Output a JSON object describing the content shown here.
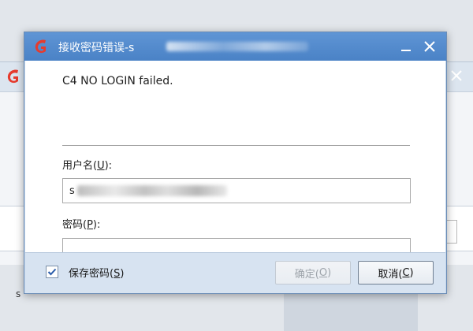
{
  "background_window": {
    "partial_letter": "s"
  },
  "dialog": {
    "title": "接收密码错误-s",
    "error_message": "C4 NO LOGIN failed.",
    "username": {
      "label": "用户名(",
      "mnemonic": "U",
      "label_end": "):",
      "value": "s"
    },
    "password": {
      "label": "密码(",
      "mnemonic": "P",
      "label_end": "):",
      "value": ""
    },
    "save_password": {
      "label": "保存密码(",
      "mnemonic": "S",
      "label_end": ")",
      "checked": true
    },
    "ok_button": {
      "label": "确定(",
      "mnemonic": "O",
      "label_end": ")",
      "enabled": false
    },
    "cancel_button": {
      "label": "取消(",
      "mnemonic": "C",
      "label_end": ")"
    }
  },
  "colors": {
    "titlebar": "#4a82c6",
    "logo": "#e63b2e",
    "footer": "#d7e3f1"
  }
}
